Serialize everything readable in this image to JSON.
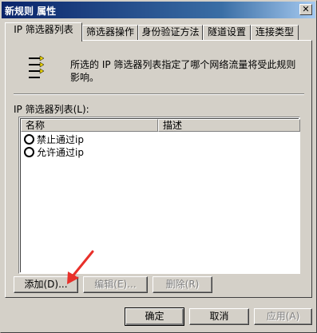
{
  "window": {
    "title": "新规则 属性",
    "close_glyph": "✕"
  },
  "tabs": [
    {
      "label": "IP 筛选器列表",
      "active": true
    },
    {
      "label": "筛选器操作",
      "active": false
    },
    {
      "label": "身份验证方法",
      "active": false
    },
    {
      "label": "隧道设置",
      "active": false
    },
    {
      "label": "连接类型",
      "active": false
    }
  ],
  "panel": {
    "icon": "filter-list-icon",
    "description": "所选的 IP 筛选器列表指定了哪个网络流量将受此规则影响。",
    "list_label": "IP 筛选器列表(L):",
    "columns": [
      "名称",
      "描述"
    ],
    "rows": [
      {
        "name": "禁止通过ip",
        "description": ""
      },
      {
        "name": "允许通过ip",
        "description": ""
      }
    ],
    "buttons": {
      "add": "添加(D)...",
      "edit": "编辑(E)...",
      "remove": "删除(R)"
    }
  },
  "footer": {
    "ok": "确定",
    "cancel": "取消",
    "apply": "应用(A)"
  },
  "colors": {
    "annotation_arrow": "#e8302a",
    "titlebar": "#0a246a"
  }
}
